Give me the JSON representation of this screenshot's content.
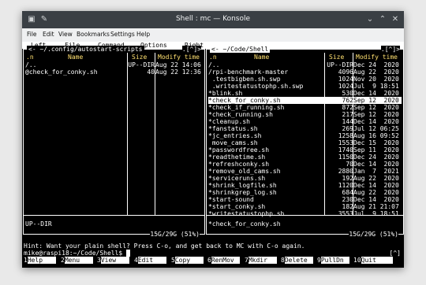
{
  "window": {
    "title": "Shell : mc — Konsole"
  },
  "menubar": [
    "File",
    "Edit",
    "View",
    "Bookmarks",
    "Settings",
    "Help"
  ],
  "topmenu": [
    "Left",
    "File",
    "Command",
    "Options",
    "Right"
  ],
  "left_panel": {
    "title": "<- ~/.config/autostart-scripts",
    "corner": ".[^]>",
    "headers": {
      "sort": ".n",
      "name": "Name",
      "size": "Size",
      "time": "Modify time"
    },
    "rows": [
      {
        "name": "/..",
        "size": "UP--DIR",
        "time": "Aug 22 14:06"
      },
      {
        "name": "@check_for_conky.sh",
        "size": "40",
        "time": "Aug 22 12:36"
      }
    ],
    "status": "UP--DIR",
    "free": "15G/29G (51%)"
  },
  "right_panel": {
    "title": "<- ~/Code/Shell",
    "corner": ".[^]>",
    "headers": {
      "sort": ".n",
      "name": "Name",
      "size": "Size",
      "time": "Modify time"
    },
    "rows": [
      {
        "name": "/..",
        "size": "UP--DIR",
        "time": "Dec 24  2020"
      },
      {
        "name": "/rpi-benchmark-master",
        "size": "4096",
        "time": "Aug 22  2020"
      },
      {
        "name": " .testbigben.sh.swp",
        "size": "1024",
        "time": "Nov 20  2020"
      },
      {
        "name": " .writestatustophp.sh.swp",
        "size": "1024",
        "time": "Jul  9 18:51"
      },
      {
        "name": "*blink.sh",
        "size": "530",
        "time": "Dec 14  2020"
      },
      {
        "name": "*check_for_conky.sh",
        "size": "762",
        "time": "Sep 12  2020",
        "selected": true
      },
      {
        "name": "*check_if_running.sh",
        "size": "872",
        "time": "Sep 12  2020"
      },
      {
        "name": "*check_running.sh",
        "size": "217",
        "time": "Sep 12  2020"
      },
      {
        "name": "*cleanup.sh",
        "size": "144",
        "time": "Dec 14  2020"
      },
      {
        "name": "*fanstatus.sh",
        "size": "269",
        "time": "Jul 12 06:25"
      },
      {
        "name": "*jc_entries.sh",
        "size": "1258",
        "time": "Aug 16 09:52"
      },
      {
        "name": " move_cams.sh",
        "size": "1553",
        "time": "Dec 15  2020"
      },
      {
        "name": "*passwordfree.sh",
        "size": "1740",
        "time": "Sep 11  2020"
      },
      {
        "name": "*readthetime.sh",
        "size": "1150",
        "time": "Dec 24  2020"
      },
      {
        "name": "*refreshconky.sh",
        "size": "70",
        "time": "Dec 14  2020"
      },
      {
        "name": "*remove_old_cams.sh",
        "size": "2880",
        "time": "Jan  7  2021"
      },
      {
        "name": "*serviceruns.sh",
        "size": "192",
        "time": "Aug 22  2020"
      },
      {
        "name": "*shrink_logfile.sh",
        "size": "1120",
        "time": "Dec 14  2020"
      },
      {
        "name": "*shrinkgrep_log.sh",
        "size": "684",
        "time": "Aug 22  2020"
      },
      {
        "name": "*start-sound",
        "size": "230",
        "time": "Dec 14  2020"
      },
      {
        "name": "*start_conky.sh",
        "size": "182",
        "time": "Aug 21 21:07"
      },
      {
        "name": "*writestatustophp.sh",
        "size": "3553",
        "time": "Jul  9 18:51"
      }
    ],
    "status": "*check_for_conky.sh",
    "free": "15G/29G (51%)"
  },
  "hint": "Hint: Want your plain shell? Press C-o, and get back to MC with C-o again.",
  "prompt": "mike@raspi18:~/Code/Shell$ ",
  "prompt_corner": "[^]",
  "fkeys": [
    {
      "n": "1",
      "label": "Help"
    },
    {
      "n": "2",
      "label": "Menu"
    },
    {
      "n": "3",
      "label": "View"
    },
    {
      "n": "4",
      "label": "Edit"
    },
    {
      "n": "5",
      "label": "Copy"
    },
    {
      "n": "6",
      "label": "RenMov"
    },
    {
      "n": "7",
      "label": "Mkdir"
    },
    {
      "n": "8",
      "label": "Delete"
    },
    {
      "n": "9",
      "label": "PullDn"
    },
    {
      "n": "10",
      "label": "Quit"
    }
  ]
}
